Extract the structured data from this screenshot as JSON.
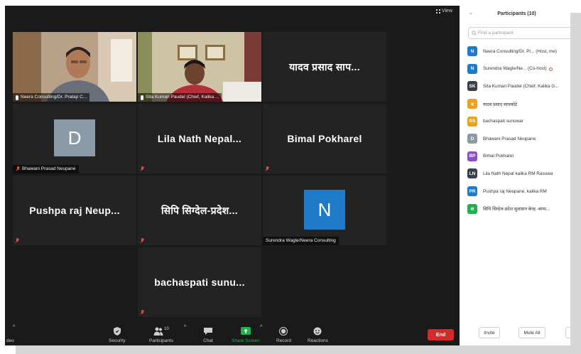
{
  "view_label": "View",
  "tiles": [
    {
      "id": "t1",
      "name": "Neera Consulting/Dr. Pratap C...",
      "type": "camera"
    },
    {
      "id": "t2",
      "name": "Sita Kumari Paudel (Chief, Kalika ...",
      "type": "camera",
      "active": true
    },
    {
      "id": "t3",
      "display": "यादव प्रसाद साप...",
      "type": "text"
    },
    {
      "id": "t4",
      "name": "Bhawani Prasad Neupane",
      "initial": "D",
      "avatar_color": "#8a9aa6",
      "type": "avatar"
    },
    {
      "id": "t5",
      "display": "Lila Nath Nepal...",
      "type": "text"
    },
    {
      "id": "t6",
      "display": "Bimal Pokharel",
      "type": "text"
    },
    {
      "id": "t7",
      "display": "Pushpa raj Neup...",
      "type": "text"
    },
    {
      "id": "t8",
      "display": "सिपि सिग्देल-प्रदेश...",
      "type": "text"
    },
    {
      "id": "t9",
      "name": "Surendra Wagle/Neera Consulting",
      "initial": "N",
      "avatar_color": "#1f7ac9",
      "type": "avatar"
    },
    {
      "id": "t10",
      "display": "bachaspati sunu...",
      "type": "text"
    }
  ],
  "toolbar": {
    "video_label": "deo",
    "security": "Security",
    "participants": "Participants",
    "participants_count": "10",
    "chat": "Chat",
    "share_screen": "Share Screen",
    "record": "Record",
    "reactions": "Reactions",
    "end": "End",
    "share_color": "#21b04b",
    "end_color": "#d62a2a"
  },
  "panel": {
    "title": "Participants (10)",
    "search_placeholder": "Find a participant",
    "participants": [
      {
        "initials": "N",
        "color": "#1f7ac9",
        "name": "Neera Consulting/Dr. Pr... (Host, me)"
      },
      {
        "initials": "N",
        "color": "#1f7ac9",
        "name": "Surendra Wagle/Ne... (Co-host)",
        "recording": true
      },
      {
        "initials": "SK",
        "color": "#3a3f4b",
        "name": "Sita Kumari Paudel (Chief, Kalika G..."
      },
      {
        "initials": "य",
        "color": "#f0a020",
        "name": "यादव प्रसाद सापकोटे"
      },
      {
        "initials": "BS",
        "color": "#f0a020",
        "name": "bachaspati sunuwar"
      },
      {
        "initials": "D",
        "color": "#8a9aa6",
        "name": "Bhawani Prasad Neupane"
      },
      {
        "initials": "BP",
        "color": "#8a4fc9",
        "name": "Bimal Pokharel"
      },
      {
        "initials": "LN",
        "color": "#3a3f4b",
        "name": "Lila Nath Nepal kalika RM Rasuwa"
      },
      {
        "initials": "PR",
        "color": "#1f7ac9",
        "name": "Pushpa raj Neupane, kalika RM"
      },
      {
        "initials": "स",
        "color": "#21b04b",
        "name": "सिपि सिग्देल-प्रदेश सुशासन केन्द्र -वाग्म..."
      }
    ],
    "invite": "Invite",
    "mute_all": "Mute All"
  }
}
